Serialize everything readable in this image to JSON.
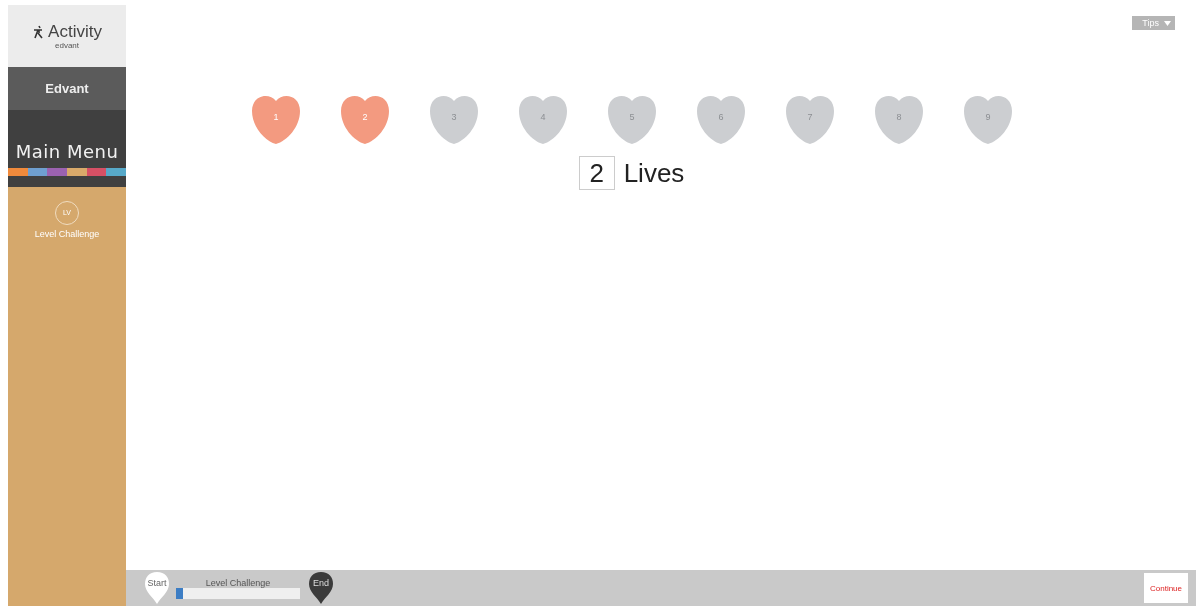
{
  "sidebar": {
    "logo": {
      "title": "Activity",
      "subtitle": "edvant"
    },
    "brand": "Edvant",
    "menu_title": "Main Menu",
    "items": [
      {
        "label": "Level Challenge",
        "badge": "LV",
        "selected": true
      }
    ]
  },
  "tips": {
    "label": "Tips"
  },
  "hearts": [
    {
      "number": "1",
      "filled": true
    },
    {
      "number": "2",
      "filled": true
    },
    {
      "number": "3",
      "filled": false
    },
    {
      "number": "4",
      "filled": false
    },
    {
      "number": "5",
      "filled": false
    },
    {
      "number": "6",
      "filled": false
    },
    {
      "number": "7",
      "filled": false
    },
    {
      "number": "8",
      "filled": false
    },
    {
      "number": "9",
      "filled": false
    }
  ],
  "lives": {
    "count": "2",
    "label": "Lives"
  },
  "footer": {
    "start": "Start",
    "end": "End",
    "progress_label": "Level Challenge",
    "level": 0.06,
    "logo": "Continue"
  }
}
